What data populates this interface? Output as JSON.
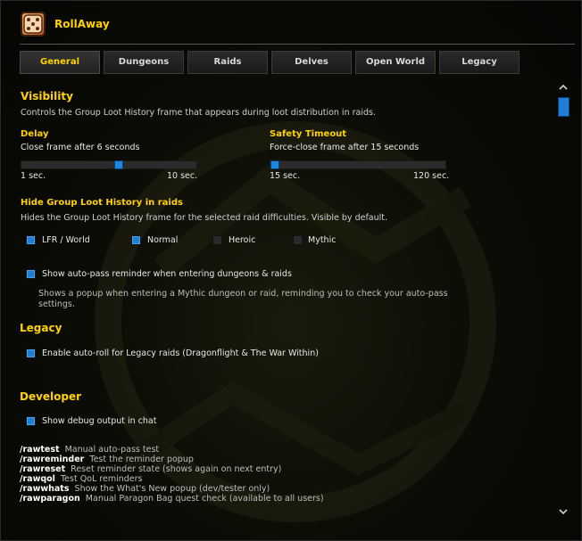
{
  "app": {
    "title": "RollAway"
  },
  "tabs": [
    {
      "label": "General",
      "active": true
    },
    {
      "label": "Dungeons",
      "active": false
    },
    {
      "label": "Raids",
      "active": false
    },
    {
      "label": "Delves",
      "active": false
    },
    {
      "label": "Open World",
      "active": false
    },
    {
      "label": "Legacy",
      "active": false
    }
  ],
  "visibility": {
    "heading": "Visibility",
    "description": "Controls the Group Loot History frame that appears during loot distribution in raids.",
    "delay": {
      "label": "Delay",
      "value_text": "Close frame after 6 seconds",
      "min_label": "1 sec.",
      "max_label": "10 sec.",
      "value": 6,
      "min": 1,
      "max": 10
    },
    "safety": {
      "label": "Safety Timeout",
      "value_text": "Force-close frame after 15 seconds",
      "min_label": "15 sec.",
      "max_label": "120 sec.",
      "value": 15,
      "min": 15,
      "max": 120
    },
    "hide": {
      "label": "Hide Group Loot History in raids",
      "description": "Hides the Group Loot History frame for the selected raid difficulties. Visible by default.",
      "options": [
        {
          "label": "LFR / World",
          "checked": true
        },
        {
          "label": "Normal",
          "checked": true
        },
        {
          "label": "Heroic",
          "checked": false
        },
        {
          "label": "Mythic",
          "checked": false
        }
      ]
    },
    "reminder": {
      "label": "Show auto-pass reminder when entering dungeons & raids",
      "checked": true,
      "description": "Shows a popup when entering a Mythic dungeon or raid, reminding you to check your auto-pass settings."
    }
  },
  "legacy": {
    "heading": "Legacy",
    "autoroll": {
      "label": "Enable auto-roll for Legacy raids (Dragonflight & The War Within)",
      "checked": true
    }
  },
  "developer": {
    "heading": "Developer",
    "debug": {
      "label": "Show debug output in chat",
      "checked": true
    },
    "commands": [
      {
        "cmd": "/rawtest",
        "desc": "Manual auto-pass test"
      },
      {
        "cmd": "/rawreminder",
        "desc": "Test the reminder popup"
      },
      {
        "cmd": "/rawreset",
        "desc": "Reset reminder state (shows again on next entry)"
      },
      {
        "cmd": "/rawqol",
        "desc": "Test QoL reminders"
      },
      {
        "cmd": "/rawwhats",
        "desc": "Show the What's New popup (dev/tester only)"
      },
      {
        "cmd": "/rawparagon",
        "desc": "Manual Paragon Bag quest check (available to all users)"
      }
    ]
  },
  "colors": {
    "accent": "#ffd200",
    "checkbox_on": "#1f7fd6",
    "slider_thumb": "#1f86e0"
  },
  "icons": {
    "logo": "dice-icon",
    "scroll_up": "chevron-up-icon",
    "scroll_down": "chevron-down-icon"
  }
}
